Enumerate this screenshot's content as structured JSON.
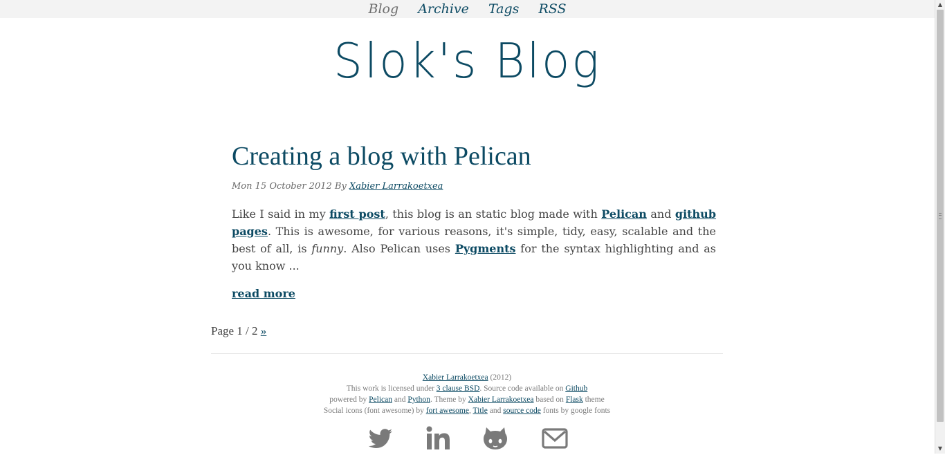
{
  "nav": {
    "items": [
      {
        "label": "Blog",
        "active": true
      },
      {
        "label": "Archive",
        "active": false
      },
      {
        "label": "Tags",
        "active": false
      },
      {
        "label": "RSS",
        "active": false
      }
    ]
  },
  "site": {
    "title": "Slok's Blog"
  },
  "article": {
    "title": "Creating a blog with Pelican",
    "date": "Mon 15 October 2012",
    "by": "By",
    "author": "Xabier Larrakoetxea",
    "excerpt": {
      "t1": "Like I said in my ",
      "l1": "first post",
      "t2": ", this blog is an static blog made with ",
      "l2": "Pelican",
      "t3": " and ",
      "l3": "github pages",
      "t4": ". This is awesome, for various reasons, it's simple, tidy, easy, scalable and the best of all, is ",
      "em": "funny",
      "t5": ". Also Pelican uses ",
      "l4": "Pygments",
      "t6": " for the syntax highlighting and as you know ..."
    },
    "read_more": "read more"
  },
  "pagination": {
    "text": "Page 1 / 2",
    "next": "»"
  },
  "footer": {
    "line1": {
      "author": "Xabier Larrakoetxea",
      "year": " (2012)"
    },
    "line2": {
      "t1": "This work is licensed under ",
      "l1": "3 clause BSD",
      "t2": ". Source code available on ",
      "l2": "Github"
    },
    "line3": {
      "t1": "powered by ",
      "l1": "Pelican",
      "t2": " and ",
      "l2": "Python",
      "t3": ". Theme by ",
      "l3": "Xabier Larrakoetxea",
      "t4": " based on ",
      "l4": "Flask",
      "t5": " theme"
    },
    "line4": {
      "t1": "Social icons (font awesome) by ",
      "l1": "fort awesome",
      "t2": ", ",
      "l2": "Title",
      "t3": " and ",
      "l3": "source code",
      "t4": " fonts by google fonts"
    }
  },
  "social": {
    "color": "#7a7a7a",
    "icons": [
      "twitter-icon",
      "linkedin-icon",
      "github-icon",
      "email-icon"
    ]
  },
  "colors": {
    "accent": "#0c4a63",
    "navbar": "#f3f3f3"
  }
}
